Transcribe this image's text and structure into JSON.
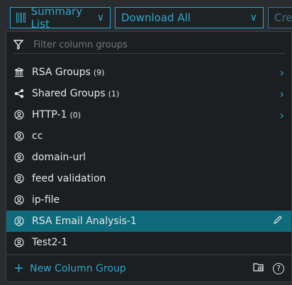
{
  "toolbar": {
    "summary_label": "Summary List",
    "download_label": "Download All",
    "create_label": "Cre"
  },
  "filter": {
    "placeholder": "Filter column groups"
  },
  "groups": [
    {
      "label": "RSA Groups",
      "count": "(9)",
      "icon": "bank-icon",
      "has_arrow": true
    },
    {
      "label": "Shared Groups",
      "count": "(1)",
      "icon": "share-icon",
      "has_arrow": true
    },
    {
      "label": "HTTP-1",
      "count": "(0)",
      "icon": "user-icon",
      "has_arrow": true
    },
    {
      "label": "cc",
      "icon": "user-icon"
    },
    {
      "label": "domain-url",
      "icon": "user-icon"
    },
    {
      "label": "feed validation",
      "icon": "user-icon"
    },
    {
      "label": "ip-file",
      "icon": "user-icon"
    },
    {
      "label": "RSA Email Analysis-1",
      "icon": "user-icon",
      "selected": true
    },
    {
      "label": "Test2-1",
      "icon": "user-icon"
    }
  ],
  "footer": {
    "new_label": "New Column Group"
  },
  "colors": {
    "accent": "#2ea6c9",
    "selected": "#0f6b7c",
    "panel": "#1c1f22"
  }
}
